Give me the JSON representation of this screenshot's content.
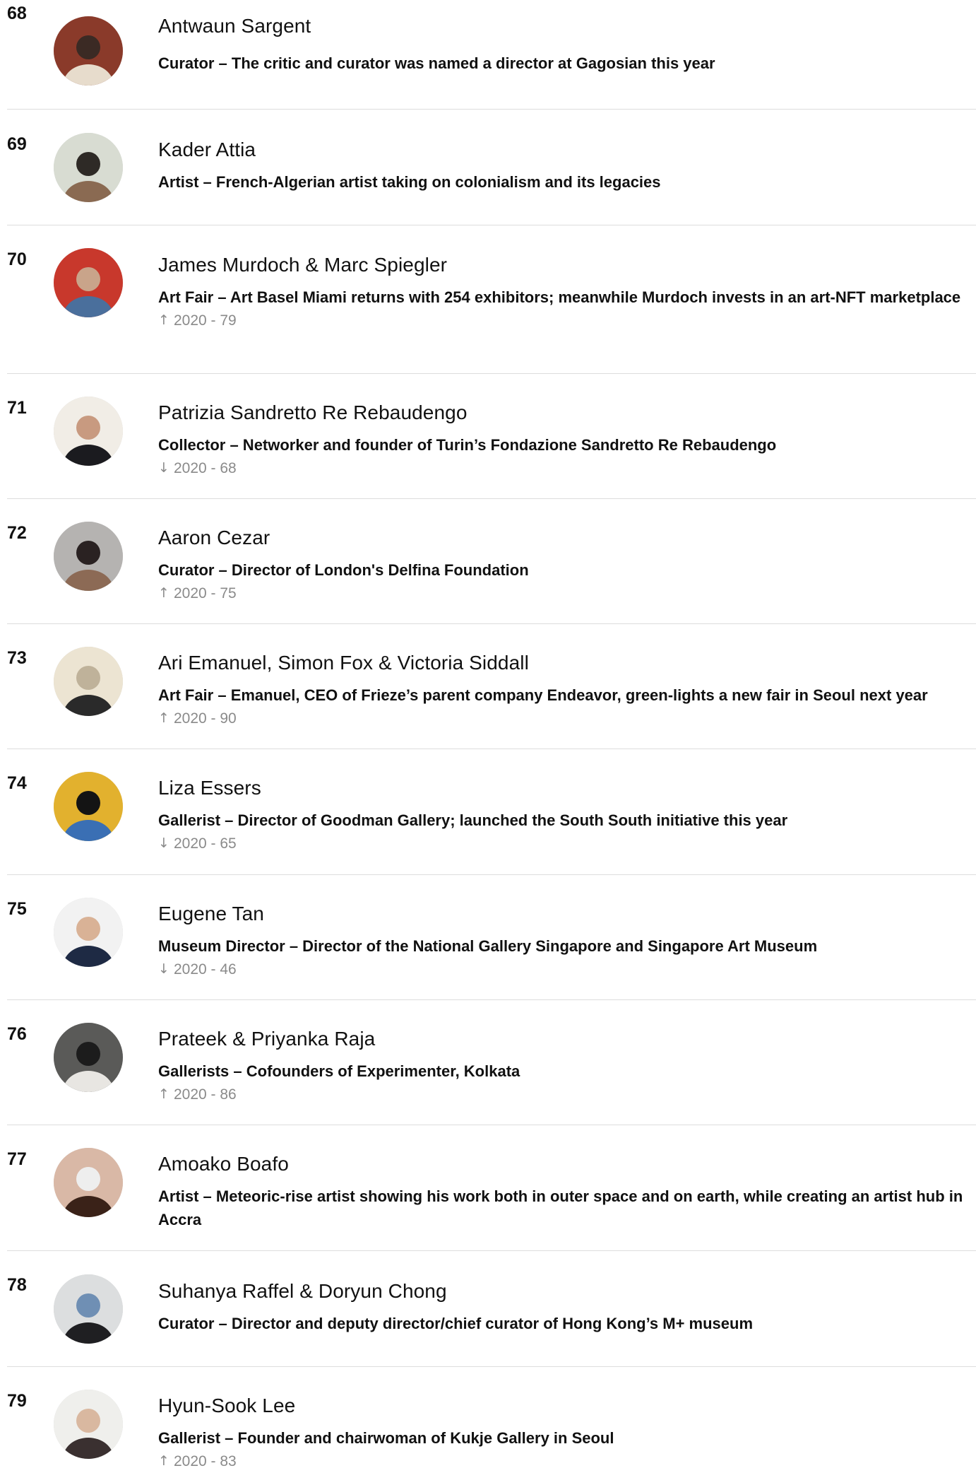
{
  "entries": [
    {
      "rank": "68",
      "name": "Antwaun Sargent",
      "description": "Curator – The critic and curator was named a director at Gagosian this year",
      "change_icon": "",
      "change": "",
      "avatar_colors": [
        "#8a3a2a",
        "#e7dccc",
        "#3b2a24"
      ]
    },
    {
      "rank": "69",
      "name": "Kader Attia",
      "description": "Artist – French-Algerian artist taking on colonialism and its legacies",
      "change_icon": "",
      "change": "",
      "avatar_colors": [
        "#d8dcd2",
        "#8a6a52",
        "#2e2a26"
      ]
    },
    {
      "rank": "70",
      "name": "James Murdoch & Marc Spiegler",
      "description": "Art Fair – Art Basel Miami returns with 254 exhibitors; meanwhile Murdoch invests in an art-NFT marketplace",
      "change_icon": "↑",
      "change": "2020 - 79",
      "avatar_colors": [
        "#c8382c",
        "#4a6f9c",
        "#c9a48a"
      ]
    },
    {
      "rank": "71",
      "name": "Patrizia Sandretto Re Rebaudengo",
      "description": "Collector – Networker and founder of Turin’s Fondazione Sandretto Re Rebaudengo",
      "change_icon": "↓",
      "change": "2020 - 68",
      "avatar_colors": [
        "#f1ede6",
        "#1b1b1f",
        "#c89a80"
      ]
    },
    {
      "rank": "72",
      "name": "Aaron Cezar",
      "description": "Curator – Director of London's Delfina Foundation",
      "change_icon": "↑",
      "change": "2020 - 75",
      "avatar_colors": [
        "#b5b3b1",
        "#8c6a55",
        "#2a2222"
      ]
    },
    {
      "rank": "73",
      "name": "Ari Emanuel, Simon Fox & Victoria Siddall",
      "description": "Art Fair – Emanuel, CEO of Frieze’s parent company Endeavor, green-lights a new fair in Seoul next year",
      "change_icon": "↑",
      "change": "2020 - 90",
      "avatar_colors": [
        "#ece4d2",
        "#2a2a2a",
        "#bfb29a"
      ]
    },
    {
      "rank": "74",
      "name": "Liza Essers",
      "description": "Gallerist – Director of Goodman Gallery; launched the South South initiative this year",
      "change_icon": "↓",
      "change": "2020 - 65",
      "avatar_colors": [
        "#e2b12e",
        "#3a6fb4",
        "#141414"
      ]
    },
    {
      "rank": "75",
      "name": "Eugene Tan",
      "description": "Museum Director – Director of the National Gallery Singapore and Singapore Art Museum",
      "change_icon": "↓",
      "change": "2020 - 46",
      "avatar_colors": [
        "#f2f2f2",
        "#1e2a44",
        "#d9b296"
      ]
    },
    {
      "rank": "76",
      "name": "Prateek & Priyanka Raja",
      "description": "Gallerists – Cofounders of Experimenter, Kolkata",
      "change_icon": "↑",
      "change": "2020 - 86",
      "avatar_colors": [
        "#5a5a58",
        "#e8e6e2",
        "#1c1c1c"
      ]
    },
    {
      "rank": "77",
      "name": "Amoako Boafo",
      "description": "Artist – Meteoric-rise artist showing his work both in outer space and on earth, while creating an artist hub in Accra",
      "change_icon": "",
      "change": "",
      "avatar_colors": [
        "#d9b8a6",
        "#3a2218",
        "#eeeeee"
      ]
    },
    {
      "rank": "78",
      "name": "Suhanya Raffel & Doryun Chong",
      "description": "Curator – Director and deputy director/chief curator of Hong Kong’s M+ museum",
      "change_icon": "",
      "change": "",
      "avatar_colors": [
        "#dcdedf",
        "#1f1f22",
        "#6f8fb4"
      ]
    },
    {
      "rank": "79",
      "name": "Hyun-Sook Lee",
      "description": "Gallerist – Founder and chairwoman of Kukje Gallery in Seoul",
      "change_icon": "↑",
      "change": "2020 - 83",
      "avatar_colors": [
        "#efefec",
        "#3a3030",
        "#d9b8a0"
      ]
    }
  ]
}
